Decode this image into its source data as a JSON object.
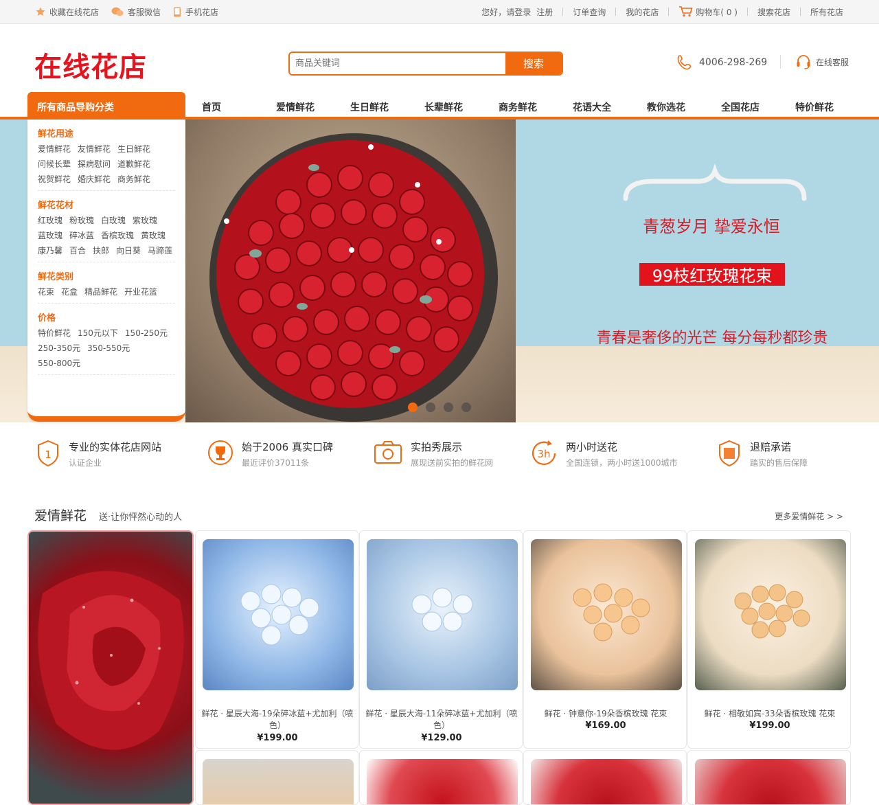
{
  "topbar": {
    "favorite": "收藏在线花店",
    "wechat": "客服微信",
    "mobile": "手机花店",
    "greeting": "您好，请登录",
    "register": "注册",
    "order_query": "订单查询",
    "my_shop": "我的花店",
    "cart": "购物车( 0 )",
    "search_shop": "搜索花店",
    "all_shops": "所有花店"
  },
  "header": {
    "logo_text": "在线花店",
    "search_placeholder": "商品关键词",
    "search_button": "搜索",
    "phone": "4006-298-269",
    "service": "在线客服",
    "accent": "#f26a0f",
    "logo_color": "#e8141d"
  },
  "nav": {
    "category_title": "所有商品导购分类",
    "items": [
      "首页",
      "爱情鲜花",
      "生日鲜花",
      "长辈鲜花",
      "商务鲜花",
      "花语大全",
      "教你选花",
      "全国花店",
      "特价鲜花"
    ]
  },
  "categories": [
    {
      "title": "鲜花用途",
      "links": [
        "爱情鲜花",
        "友情鲜花",
        "生日鲜花",
        "问候长辈",
        "探病慰问",
        "道歉鲜花",
        "祝贺鲜花",
        "婚庆鲜花",
        "商务鲜花"
      ]
    },
    {
      "title": "鲜花花材",
      "links": [
        "红玫瑰",
        "粉玫瑰",
        "白玫瑰",
        "紫玫瑰",
        "蓝玫瑰",
        "碎冰蓝",
        "香槟玫瑰",
        "黄玫瑰",
        "康乃馨",
        "百合",
        "扶郎",
        "向日葵",
        "马蹄莲"
      ]
    },
    {
      "title": "鲜花类别",
      "links": [
        "花束",
        "花盒",
        "精品鲜花",
        "开业花篮"
      ]
    },
    {
      "title": "价格",
      "links": [
        "特价鲜花",
        "150元以下",
        "150-250元",
        "250-350元",
        "350-550元",
        "550-800元"
      ]
    }
  ],
  "banner": {
    "line1": "青葱岁月  挚爱永恒",
    "line2": "99枝红玫瑰花束",
    "line3": "青春是奢侈的光芒  每分每秒都珍贵",
    "slide_count": 4,
    "active_slide": 1
  },
  "features": [
    {
      "icon": "shield-1-icon",
      "title": "专业的实体花店网站",
      "sub": "认证企业"
    },
    {
      "icon": "trophy-icon",
      "title": "始于2006 真实口碑",
      "sub": "最近评价37011条"
    },
    {
      "icon": "camera-icon",
      "title": "实拍秀展示",
      "sub": "展现送前实拍的鲜花网"
    },
    {
      "icon": "3h-clock-icon",
      "title": "两小时送花",
      "sub": "全国连锁，两小时送1000城市"
    },
    {
      "icon": "compensation-shield-icon",
      "title": "退赔承诺",
      "sub": "踏实的售后保障"
    }
  ],
  "section": {
    "title": "爱情鲜花",
    "subtitle": "送·让你怦然心动的人",
    "more": "更多爱情鲜花 > >"
  },
  "products": [
    {
      "name": "鲜花 · 星辰大海-19朵碎冰蓝+尤加利（喷色）",
      "price": "¥199.00"
    },
    {
      "name": "鲜花 · 星辰大海-11朵碎冰蓝+尤加利（喷色）",
      "price": "¥129.00"
    },
    {
      "name": "鲜花 · 钟意你-19朵香槟玫瑰 花束",
      "price": "¥169.00"
    },
    {
      "name": "鲜花 · 相敬如宾-33朵香槟玫瑰 花束",
      "price": "¥199.00"
    }
  ]
}
